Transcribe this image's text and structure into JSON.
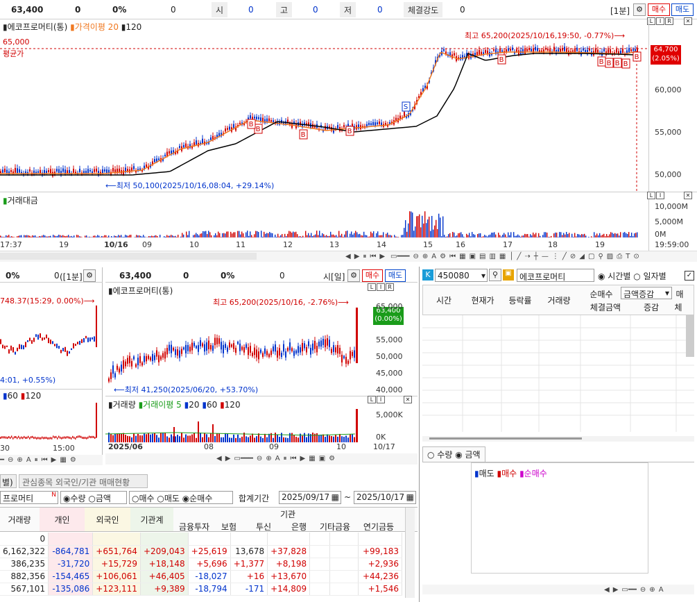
{
  "header": {
    "price": "63,400",
    "change": "0",
    "rate": "0%",
    "volume": "0",
    "open_label": "시",
    "open_val": "0",
    "high_label": "고",
    "high_val": "0",
    "low_label": "저",
    "low_val": "0",
    "strength_label": "체결강도",
    "strength_val": "0",
    "period": "[1분]",
    "buy": "매수",
    "sell": "매도"
  },
  "main_chart": {
    "legend_name": "에코프로머티(통)",
    "legend_ma": "가격이평 20",
    "legend_ma2": "120",
    "high_note": "최고 65,200(2025/10/16,19:50, -0.77%)⟶",
    "low_note": "⟵최저 50,100(2025/10/16,08:04, +29.14%)",
    "avg_label": "평균가",
    "avg_value": "65,000",
    "price_tag": "64,700",
    "price_tag_rate": "(2.05%)",
    "y_ticks": [
      "60,000",
      "55,000",
      "50,000"
    ],
    "vol_title": "거래대금",
    "vol_ticks": [
      "10,000M",
      "5,000M",
      "0M"
    ],
    "x_ticks": [
      "17:37",
      "19",
      "10/16",
      "09",
      "10",
      "11",
      "12",
      "13",
      "14",
      "15",
      "16",
      "17",
      "18",
      "19",
      "19:59:00"
    ],
    "markers": [
      "B",
      "B",
      "B",
      "B",
      "S",
      "B",
      "B",
      "B",
      "B",
      "B",
      "B"
    ]
  },
  "mini_chart_left": {
    "price": "0%",
    "change": "0",
    "period": "([1분]",
    "note_high": "748.37(15:29, 0.00%)⟶",
    "note_low": "4:01, +0.55%)",
    "legend": [
      "60",
      "120"
    ],
    "x_ticks": [
      "30",
      "15:00"
    ]
  },
  "daily_chart": {
    "price": "63,400",
    "change": "0",
    "rate": "0%",
    "volume": "0",
    "period": "시[일]",
    "buy": "매수",
    "sell": "매도",
    "legend_name": "에코프로머티(통)",
    "high_note": "최고 65,200(2025/10/16, -2.76%)⟶",
    "low_note": "⟵최저 41,250(2025/06/20, +53.70%)",
    "price_tag": "63,400",
    "price_tag_rate": "(0.00%)",
    "y_ticks": [
      "65,000",
      "55,000",
      "50,000",
      "45,000",
      "40,000"
    ],
    "vol_legend": [
      "거래량",
      "거래이평 5",
      "20",
      "60",
      "120"
    ],
    "vol_ticks": [
      "5,000K",
      "0K"
    ],
    "x_ticks": [
      "2025/06",
      "08",
      "09",
      "10",
      "10/17"
    ]
  },
  "investor_panel": {
    "code": "450080",
    "name": "에코프로머티",
    "opt_time": "시간별",
    "opt_day": "일자별",
    "net_buy": "순매수",
    "amount_delta": "금액증감",
    "col_buy_short": "매",
    "headers": [
      "시간",
      "현재가",
      "등락률",
      "거래량"
    ],
    "sub_headers": [
      "체결금액",
      "증감",
      "체"
    ],
    "radio_qty": "수량",
    "radio_amt": "금액",
    "legend": [
      "매도",
      "매수",
      "순매수"
    ]
  },
  "bottom_table": {
    "tabs": [
      "별)",
      "관심종목 외국인/기관 매매현황"
    ],
    "name": "프로머티",
    "r_qty": "수량",
    "r_amt": "금액",
    "r_buy": "매수",
    "r_sell": "매도",
    "r_net": "순매수",
    "period_label": "합계기간",
    "date_from": "2025/09/17",
    "date_to": "2025/10/17",
    "tilde": "~",
    "col_inst": "기관",
    "cols": [
      "거래량",
      "개인",
      "외국인",
      "기관계",
      "금융투자",
      "보험",
      "투신",
      "은행",
      "기타금융",
      "연기금등"
    ],
    "rows": [
      [
        "0",
        "",
        "",
        "",
        "",
        "",
        "",
        "",
        "",
        ""
      ],
      [
        "6,162,322",
        "-864,781",
        "+651,764",
        "+209,043",
        "+25,619",
        "13,678",
        "+37,828",
        "",
        "",
        "+99,183"
      ],
      [
        "386,235",
        "-31,720",
        "+15,729",
        "+18,148",
        "+5,696",
        "+1,377",
        "+8,198",
        "",
        "",
        "+2,936"
      ],
      [
        "882,356",
        "-154,465",
        "+106,061",
        "+46,405",
        "-18,027",
        "+16",
        "+13,670",
        "",
        "",
        "+44,236"
      ],
      [
        "567,101",
        "-135,086",
        "+123,111",
        "+9,389",
        "-18,794",
        "-171",
        "+14,809",
        "",
        "",
        "+1,546"
      ]
    ]
  },
  "colors": {
    "up": "#d00000",
    "down": "#0033cc",
    "ma20": "#f07820",
    "ma120": "#000000",
    "accent_blue": "#1a74c9"
  }
}
